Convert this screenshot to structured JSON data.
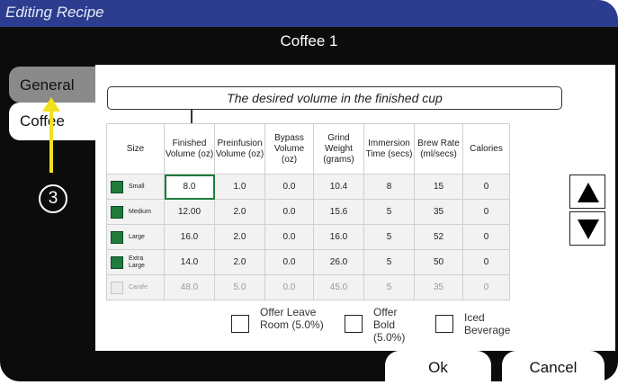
{
  "window": {
    "title": "Editing Recipe"
  },
  "recipe": {
    "name": "Coffee 1"
  },
  "tabs": [
    {
      "label": "General",
      "selected": false
    },
    {
      "label": "Coffee",
      "selected": true
    }
  ],
  "description": "The desired volume in the finished cup",
  "table": {
    "headers": [
      "Size",
      "Finished Volume (oz)",
      "Preinfusion Volume (oz)",
      "Bypass Volume (oz)",
      "Grind Weight (grams)",
      "Immersion Time (secs)",
      "Brew Rate (ml/secs)",
      "Calories"
    ],
    "rows": [
      {
        "size": "Small",
        "enabled": true,
        "values": [
          "8.0",
          "1.0",
          "0.0",
          "10.4",
          "8",
          "15",
          "0"
        ]
      },
      {
        "size": "Medium",
        "enabled": true,
        "values": [
          "12.00",
          "2.0",
          "0.0",
          "15.6",
          "5",
          "35",
          "0"
        ]
      },
      {
        "size": "Large",
        "enabled": true,
        "values": [
          "16.0",
          "2.0",
          "0.0",
          "16.0",
          "5",
          "52",
          "0"
        ]
      },
      {
        "size": "Extra Large",
        "enabled": true,
        "values": [
          "14.0",
          "2.0",
          "0.0",
          "26.0",
          "5",
          "50",
          "0"
        ]
      },
      {
        "size": "Carafe",
        "enabled": false,
        "values": [
          "48.0",
          "5.0",
          "0.0",
          "45.0",
          "5",
          "35",
          "0"
        ]
      }
    ]
  },
  "options": [
    {
      "label": "Offer Leave Room (5.0%)",
      "checked": false
    },
    {
      "label": "Offer Bold (5.0%)",
      "checked": false
    },
    {
      "label": "Iced Beverage",
      "checked": false
    }
  ],
  "buttons": {
    "ok": "Ok",
    "cancel": "Cancel"
  },
  "annotation": {
    "step": "3"
  },
  "colors": {
    "titlebar": "#2c3d8f",
    "checked": "#1f7a3c",
    "frame": "#0c0c0c",
    "annotation": "#f2e21c"
  }
}
